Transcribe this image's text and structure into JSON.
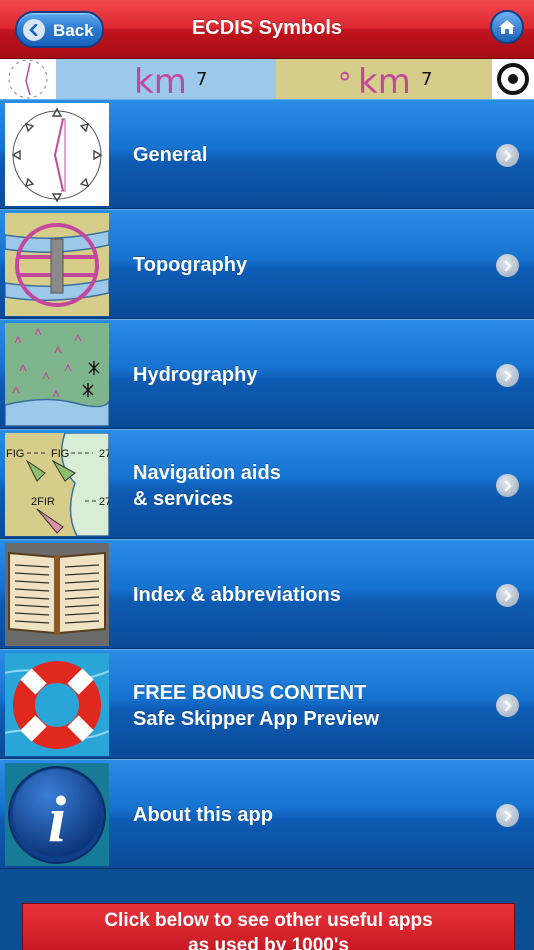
{
  "header": {
    "title": "ECDIS Symbols",
    "back_label": "Back"
  },
  "strip": {
    "left_km": "km",
    "left_num": "7",
    "right_prefix": "∘",
    "right_km": "km",
    "right_num": "7"
  },
  "menu": {
    "items": [
      {
        "line1": "General",
        "line2": ""
      },
      {
        "line1": "Topography",
        "line2": ""
      },
      {
        "line1": "Hydrography",
        "line2": ""
      },
      {
        "line1": "Navigation aids",
        "line2": "& services"
      },
      {
        "line1": "Index & abbreviations",
        "line2": ""
      },
      {
        "line1": "FREE BONUS CONTENT",
        "line2": "Safe Skipper App Preview"
      },
      {
        "line1": "About this app",
        "line2": ""
      }
    ]
  },
  "thumb_text": {
    "fig1": "FIG",
    "fig2": "FIG",
    "n27a": "27",
    "fir": "2FIR",
    "n27b": "27",
    "info": "i"
  },
  "footer": {
    "line1": "Click below to see other useful apps",
    "line2": "as used by 1000's"
  },
  "colors": {
    "header_red": "#dc2630",
    "row_blue": "#1672cf",
    "magenta": "#c3489d",
    "chart_tan": "#d6cd8a",
    "strip_blue": "#9cc8ea"
  },
  "icons": {
    "back": "chevron-left-icon",
    "home": "home-icon",
    "row_arrow": "chevron-right-icon"
  }
}
